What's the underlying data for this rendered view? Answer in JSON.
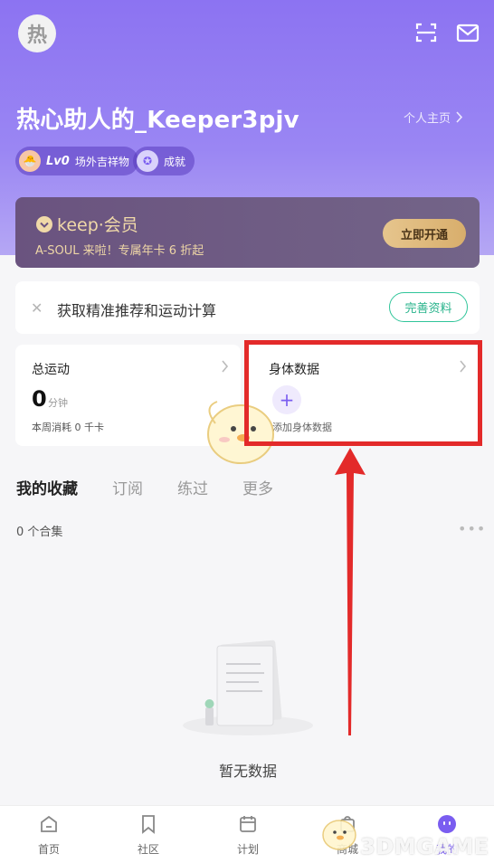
{
  "header": {
    "avatar_text": "热",
    "username": "热心助人的_Keeper3pjv",
    "profile_link": "个人主页",
    "level": "Lv0",
    "mascot_label": "场外吉祥物",
    "achievement_label": "成就",
    "icons": [
      "scan-icon",
      "mail-icon"
    ]
  },
  "vip": {
    "brand": "keep·会员",
    "promo": "A-SOUL 来啦！专属年卡 6 折起",
    "button": "立即开通"
  },
  "tip": {
    "text": "获取精准推荐和运动计算",
    "button": "完善资料"
  },
  "stats": {
    "exercise_title": "总运动",
    "exercise_value": "0",
    "exercise_unit": "分钟",
    "exercise_sub": "本周消耗 0 千卡",
    "body_title": "身体数据",
    "body_add": "添加身体数据"
  },
  "tabs": [
    "我的收藏",
    "订阅",
    "练过",
    "更多"
  ],
  "collection_count": "0 个合集",
  "empty_text": "暂无数据",
  "tabbar": [
    "首页",
    "社区",
    "计划",
    "商城",
    "我的"
  ],
  "watermark": "3DMGAME",
  "colors": {
    "hero": "#8c73f2",
    "accent_green": "#30c59a",
    "highlight_red": "#e32a2a",
    "vip_gold": "#e6c58d"
  }
}
